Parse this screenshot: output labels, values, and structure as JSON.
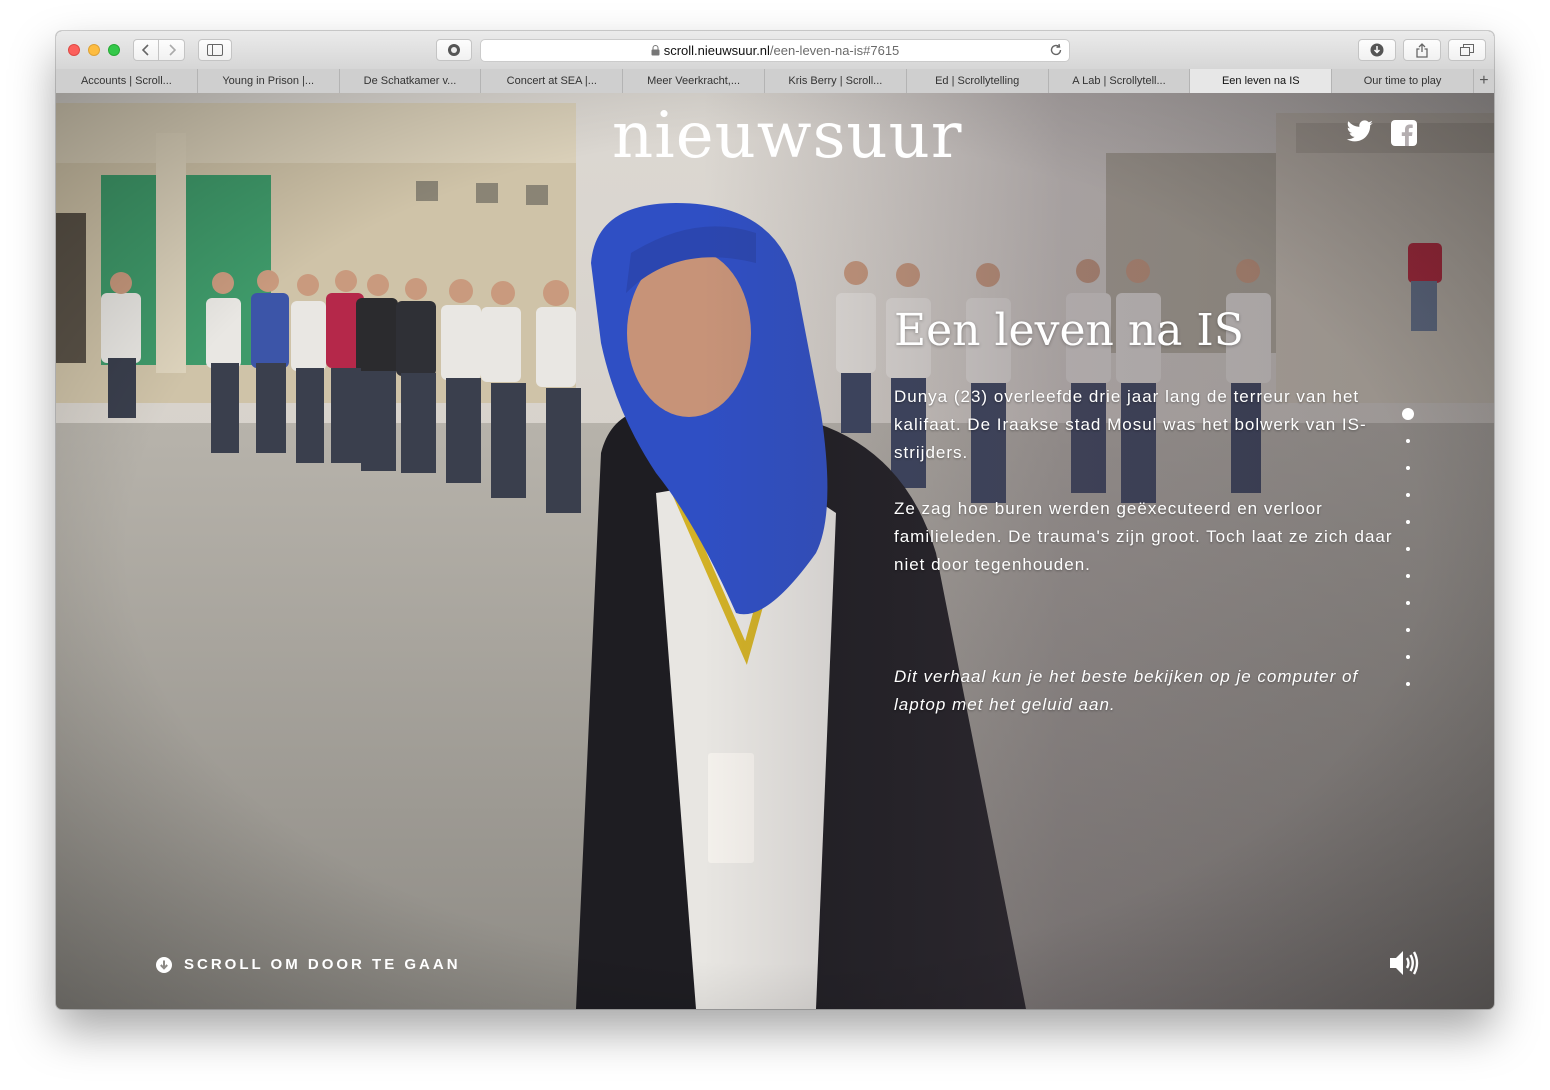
{
  "browser": {
    "url_domain": "scroll.nieuwsuur.nl",
    "url_path": "/een-leven-na-is#7615",
    "tabs": [
      {
        "label": "Accounts | Scroll..."
      },
      {
        "label": "Young in Prison |..."
      },
      {
        "label": "De Schatkamer v..."
      },
      {
        "label": "Concert at SEA |..."
      },
      {
        "label": "Meer Veerkracht,..."
      },
      {
        "label": "Kris Berry | Scroll..."
      },
      {
        "label": "Ed | Scrollytelling"
      },
      {
        "label": "A Lab | Scrollytell..."
      },
      {
        "label": "Een leven na IS"
      },
      {
        "label": "Our time to play"
      }
    ],
    "active_tab_index": 8,
    "new_tab_label": "+"
  },
  "page": {
    "logo": "nieuwsuur",
    "headline": "Een leven na IS",
    "paragraphs": [
      "Dunya (23) overleefde drie jaar lang de terreur van het kalifaat. De Iraakse stad Mosul was het bolwerk van IS-strijders.",
      "Ze zag hoe buren werden geëxecuteerd en verloor familieleden. De trauma's zijn groot. Toch laat ze zich daar niet door tegenhouden."
    ],
    "note": "Dit verhaal kun je het beste bekijken op je computer of laptop met het geluid aan.",
    "scroll_cta": "SCROLL OM DOOR TE GAAN",
    "nav_dots_count": 11,
    "nav_dots_active": 1
  },
  "icons": {
    "twitter": "twitter-icon",
    "facebook": "facebook-icon",
    "sound": "speaker-icon",
    "scroll": "arrow-down-circle-icon"
  },
  "colors": {
    "hijab": "#2f4fc4",
    "text": "#ffffff"
  }
}
